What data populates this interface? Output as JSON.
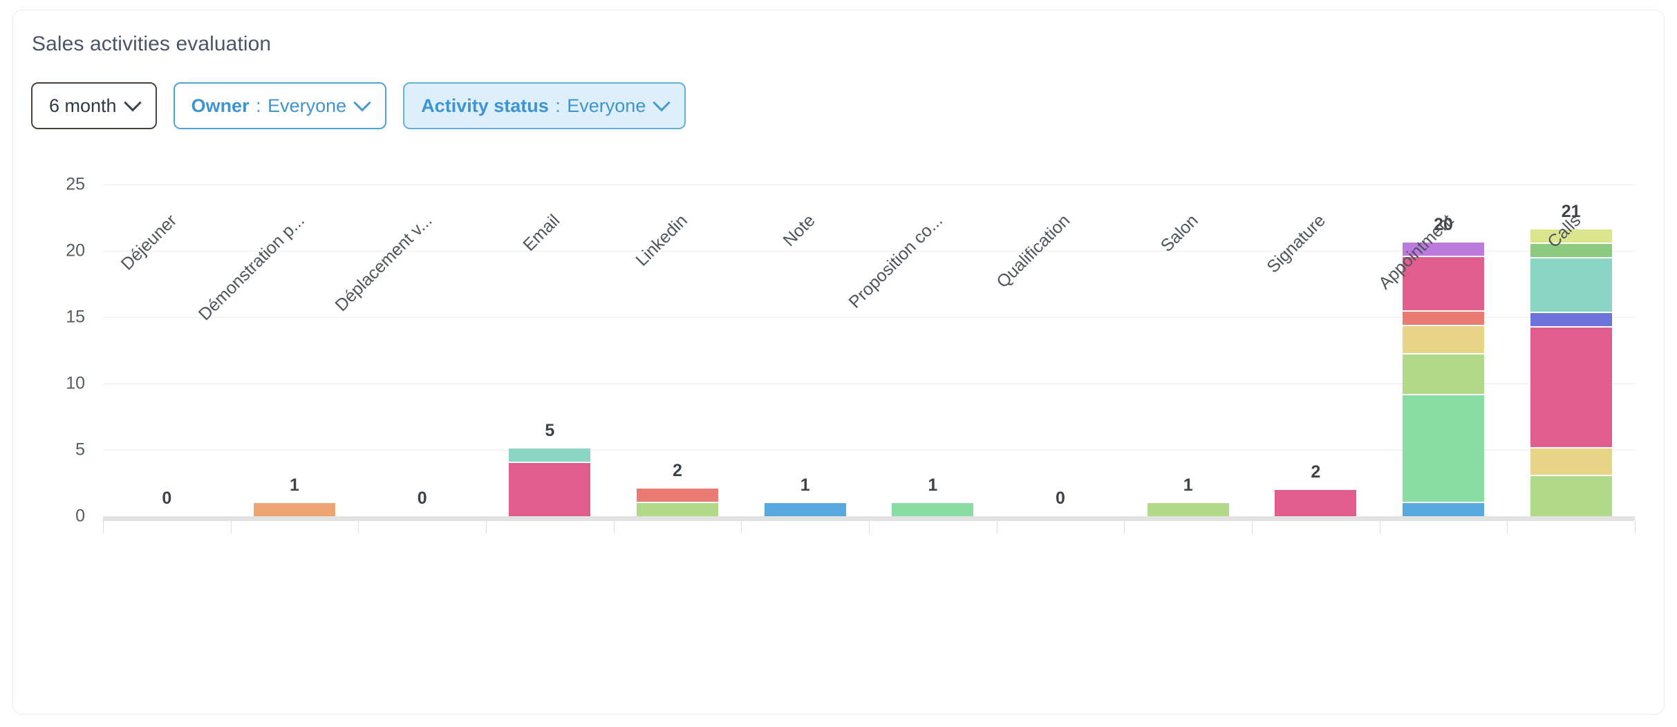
{
  "card": {
    "title": "Sales activities evaluation"
  },
  "filters": [
    {
      "name": "period-filter",
      "label": "",
      "value": "6 month",
      "separator": "",
      "style": "dark",
      "icon": "chevron-down-icon"
    },
    {
      "name": "owner-filter",
      "label": "Owner",
      "value": "Everyone",
      "separator": ":",
      "style": "blue",
      "icon": "chevron-down-icon"
    },
    {
      "name": "activity-status-filter",
      "label": "Activity status",
      "value": "Everyone",
      "separator": ":",
      "style": "blue-filled",
      "icon": "chevron-down-icon"
    }
  ],
  "chart_data": {
    "type": "bar",
    "title": "Sales activities evaluation",
    "subtitle": "",
    "xlabel": "",
    "ylabel": "",
    "stacked": true,
    "grid": true,
    "legend": "none",
    "ylim": [
      0,
      25
    ],
    "yticks": [
      0,
      5,
      10,
      15,
      20,
      25
    ],
    "categories": [
      "Déjeuner",
      "Démonstration p...",
      "Déplacement v...",
      "Email",
      "Linkedin",
      "Note",
      "Proposition co...",
      "Qualification",
      "Salon",
      "Signature",
      "Appointment",
      "Calls"
    ],
    "totals": [
      0,
      1,
      0,
      5,
      2,
      1,
      1,
      0,
      1,
      2,
      20,
      21
    ],
    "stacks": [
      [],
      [
        {
          "value": 1,
          "color": "#eda470"
        }
      ],
      [],
      [
        {
          "value": 4,
          "color": "#e05d8e"
        },
        {
          "value": 1,
          "color": "#8bd5c4"
        }
      ],
      [
        {
          "value": 1,
          "color": "#b0d98a"
        },
        {
          "value": 1,
          "color": "#ea7b72"
        }
      ],
      [
        {
          "value": 1,
          "color": "#56a8de"
        }
      ],
      [
        {
          "value": 1,
          "color": "#87dda2"
        }
      ],
      [],
      [
        {
          "value": 1,
          "color": "#b0d98a"
        }
      ],
      [
        {
          "value": 2,
          "color": "#e05d8e"
        }
      ],
      [
        {
          "value": 1,
          "color": "#56a8de"
        },
        {
          "value": 8,
          "color": "#87dda2"
        },
        {
          "value": 3,
          "color": "#b0d98a"
        },
        {
          "value": 2,
          "color": "#e8d487"
        },
        {
          "value": 1,
          "color": "#ea7b72"
        },
        {
          "value": 4,
          "color": "#e05d8e"
        },
        {
          "value": 1,
          "color": "#bb7adc"
        }
      ],
      [
        {
          "value": 3,
          "color": "#b0d98a"
        },
        {
          "value": 2,
          "color": "#e8d487"
        },
        {
          "value": 9,
          "color": "#e05d8e"
        },
        {
          "value": 1,
          "color": "#6c74db"
        },
        {
          "value": 4,
          "color": "#8bd5c4"
        },
        {
          "value": 1,
          "color": "#8ccb7f"
        },
        {
          "value": 1,
          "color": "#dbe58c"
        }
      ]
    ],
    "colors": {
      "orange": "#eda470",
      "pink": "#e05d8e",
      "teal": "#8bd5c4",
      "light-green": "#b0d98a",
      "salmon": "#ea7b72",
      "blue": "#56a8de",
      "green": "#87dda2",
      "yellow": "#e8d487",
      "purple": "#bb7adc",
      "indigo": "#6c74db",
      "mid-green": "#8ccb7f",
      "khaki": "#dbe58c"
    }
  }
}
